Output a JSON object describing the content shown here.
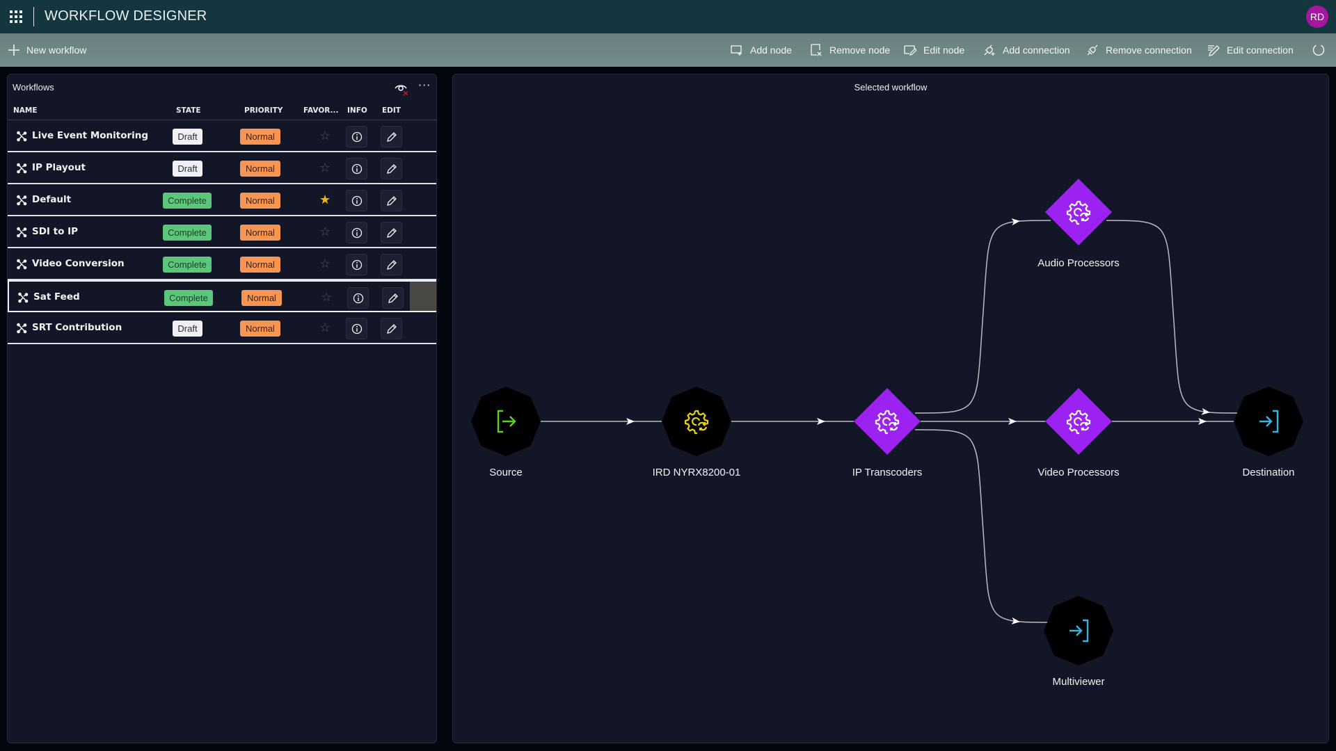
{
  "app": {
    "title": "WORKFLOW DESIGNER",
    "user_initials": "RD",
    "avatar_color": "#a4179e"
  },
  "toolbar": {
    "new_workflow": "New workflow",
    "add_node": "Add node",
    "remove_node": "Remove node",
    "edit_node": "Edit node",
    "add_connection": "Add connection",
    "remove_connection": "Remove connection",
    "edit_connection": "Edit connection",
    "refresh_icon": "refresh-icon"
  },
  "workflows_panel": {
    "title": "Workflows",
    "columns": {
      "name": "NAME",
      "state": "STATE",
      "priority": "PRIORITY",
      "favorite": "FAVOR...",
      "info": "INFO",
      "edit": "EDIT"
    },
    "rows": [
      {
        "name": "Live Event Monitoring",
        "state": "Draft",
        "priority": "Normal",
        "favorite": false,
        "selected": false
      },
      {
        "name": "IP Playout",
        "state": "Draft",
        "priority": "Normal",
        "favorite": false,
        "selected": false
      },
      {
        "name": "Default",
        "state": "Complete",
        "priority": "Normal",
        "favorite": true,
        "selected": false
      },
      {
        "name": "SDI to IP",
        "state": "Complete",
        "priority": "Normal",
        "favorite": false,
        "selected": false
      },
      {
        "name": "Video Conversion",
        "state": "Complete",
        "priority": "Normal",
        "favorite": false,
        "selected": false
      },
      {
        "name": "Sat Feed",
        "state": "Complete",
        "priority": "Normal",
        "favorite": false,
        "selected": true
      },
      {
        "name": "SRT Contribution",
        "state": "Draft",
        "priority": "Normal",
        "favorite": false,
        "selected": false
      }
    ]
  },
  "selected_workflow": {
    "title": "Selected workflow",
    "nodes": [
      {
        "id": "source",
        "label": "Source",
        "shape": "octagon",
        "icon": "source-exit-icon",
        "icon_color": "#5fd11d"
      },
      {
        "id": "ird",
        "label": "IRD NYRX8200-01",
        "shape": "octagon",
        "icon": "gear-sync-icon",
        "icon_color": "#e8d210"
      },
      {
        "id": "iptx",
        "label": "IP Transcoders",
        "shape": "diamond",
        "icon": "gear-sync-icon",
        "icon_color": "#ffffff",
        "fill": "#9b22f0"
      },
      {
        "id": "audio",
        "label": "Audio Processors",
        "shape": "diamond",
        "icon": "gear-sync-icon",
        "icon_color": "#ffffff",
        "fill": "#9b22f0"
      },
      {
        "id": "video",
        "label": "Video Processors",
        "shape": "diamond",
        "icon": "gear-sync-icon",
        "icon_color": "#ffffff",
        "fill": "#9b22f0"
      },
      {
        "id": "dest",
        "label": "Destination",
        "shape": "octagon",
        "icon": "destination-enter-icon",
        "icon_color": "#35b6e0"
      },
      {
        "id": "mv",
        "label": "Multiviewer",
        "shape": "octagon",
        "icon": "destination-enter-icon",
        "icon_color": "#35b6e0"
      }
    ],
    "connections": [
      {
        "from": "source",
        "to": "ird"
      },
      {
        "from": "ird",
        "to": "iptx"
      },
      {
        "from": "iptx",
        "to": "audio"
      },
      {
        "from": "iptx",
        "to": "video"
      },
      {
        "from": "iptx",
        "to": "mv"
      },
      {
        "from": "audio",
        "to": "dest"
      },
      {
        "from": "video",
        "to": "dest"
      }
    ]
  },
  "colors": {
    "draft": "#eef0f3",
    "complete": "#5bc77a",
    "priority_normal": "#f79552",
    "favorite_on": "#f2b705",
    "diamond_fill": "#9b22f0"
  }
}
